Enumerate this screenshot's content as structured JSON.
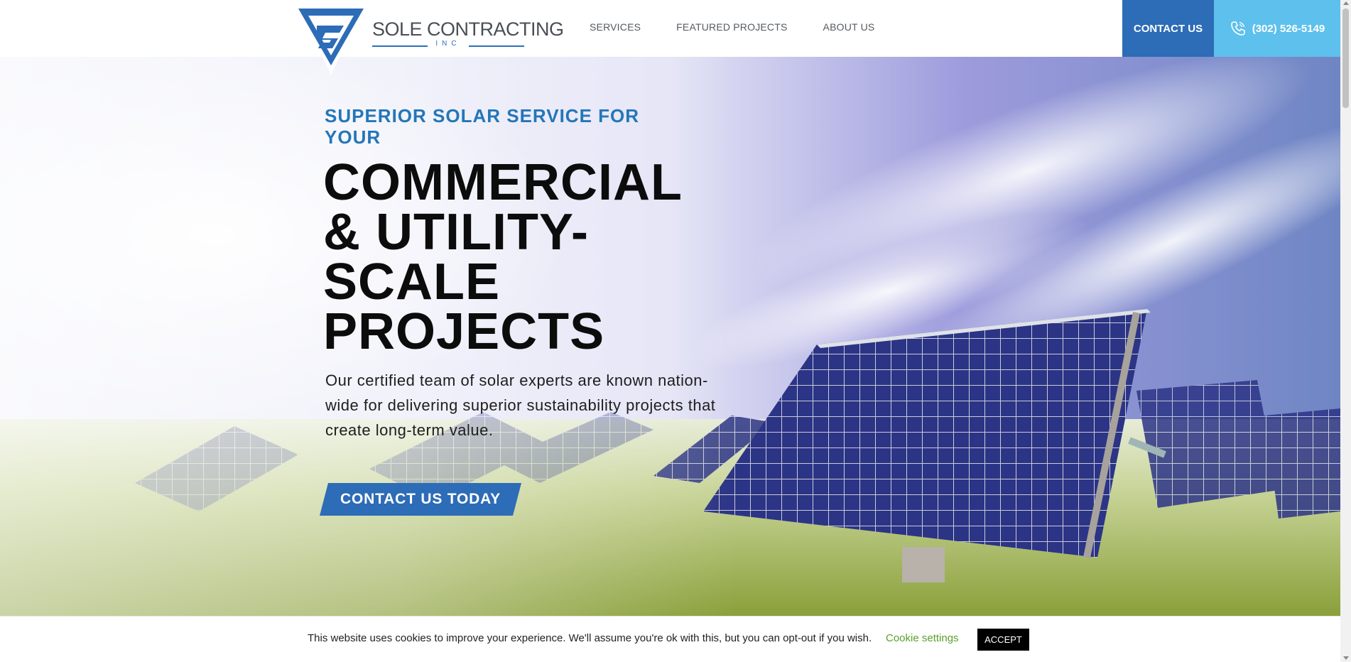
{
  "header": {
    "logo": {
      "name": "SOLE CONTRACTING",
      "sub": "INC"
    },
    "nav": [
      {
        "label": "SERVICES"
      },
      {
        "label": "FEATURED PROJECTS"
      },
      {
        "label": "ABOUT US"
      }
    ],
    "contact_label": "CONTACT US",
    "phone": "(302) 526-5149"
  },
  "hero": {
    "eyebrow": "SUPERIOR SOLAR SERVICE FOR YOUR",
    "headline": "COMMERCIAL & UTILITY-SCALE PROJECTS",
    "subtext": "Our certified team of solar experts are known nation-wide for delivering superior sustainability projects that create long-term value.",
    "cta_label": "CONTACT US TODAY"
  },
  "cookie": {
    "text": "This website uses cookies to improve your experience. We'll assume you're ok with this, but you can opt-out if you wish.",
    "settings_label": "Cookie settings",
    "accept_label": "ACCEPT"
  },
  "colors": {
    "brand_blue": "#2d6cb6",
    "light_blue": "#5ec0ec",
    "eyebrow_blue": "#2476b8",
    "cookie_link_green": "#5aa02c"
  },
  "icons": {
    "logo_mark": "triangle-logo-icon",
    "phone": "phone-icon"
  }
}
